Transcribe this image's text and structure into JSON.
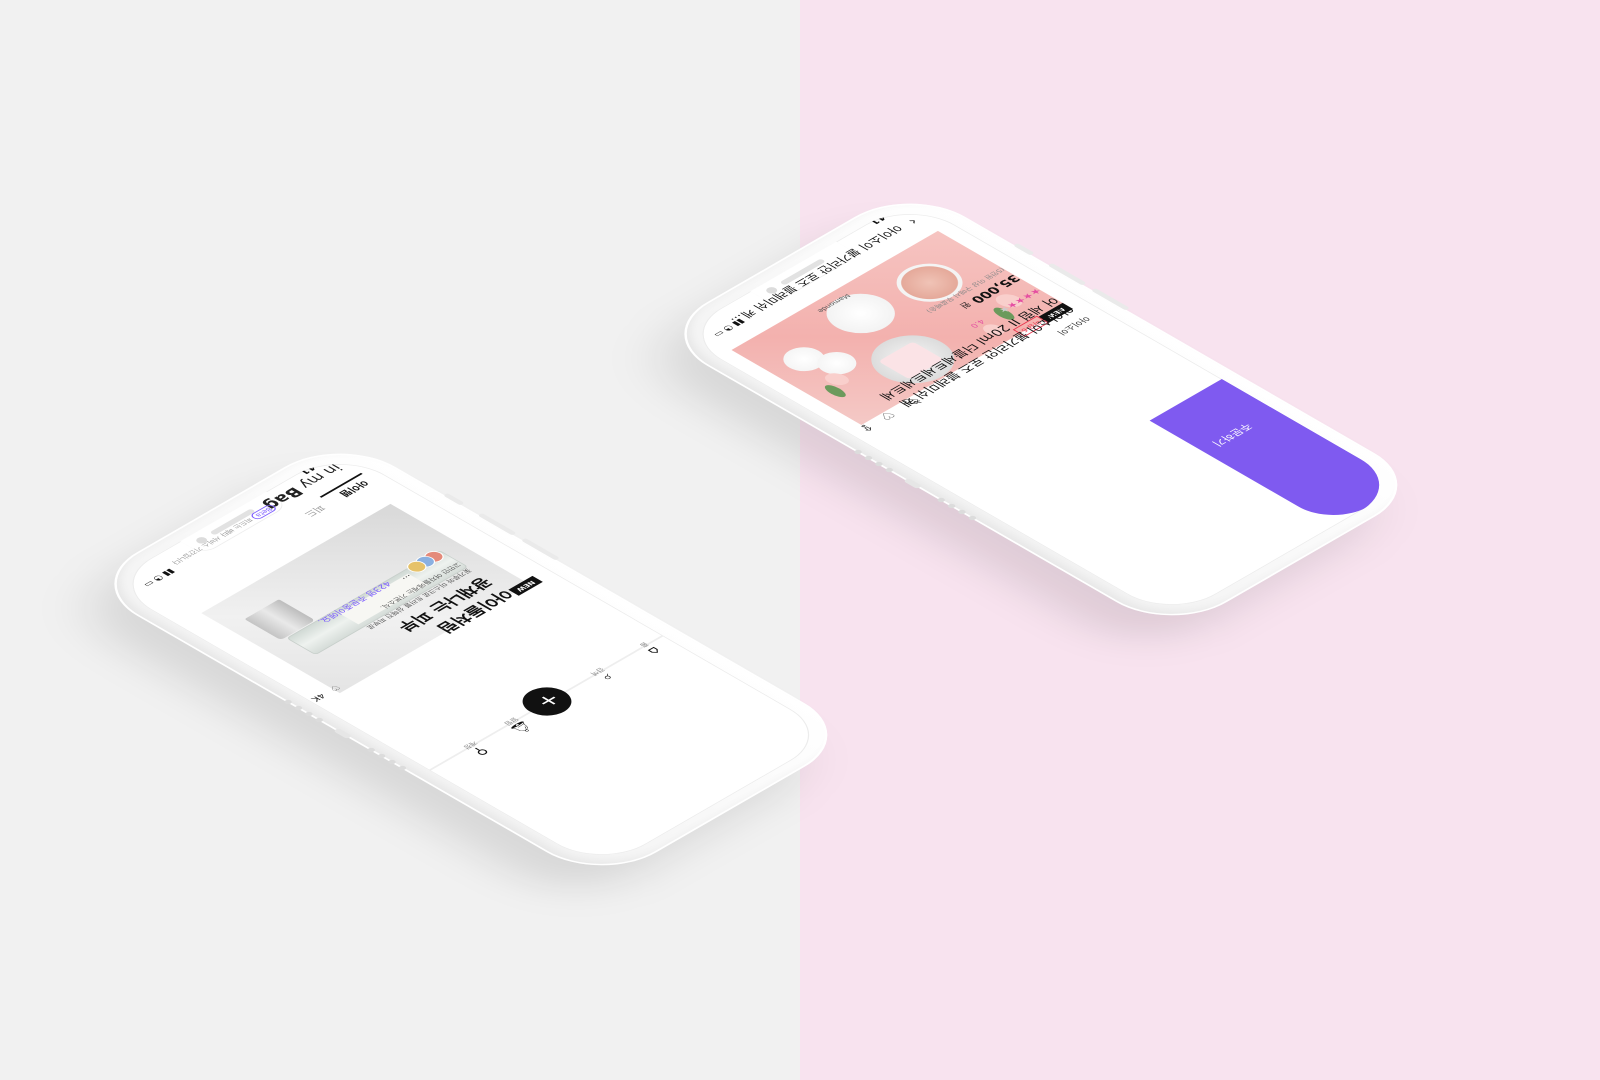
{
  "left_phone": {
    "status": {
      "time": "9:41"
    },
    "header": {
      "logo_light": "in my",
      "logo_bold": "Bag",
      "beta_badge": "Beta",
      "tagline": "피드는 베타 서비스 기간입니다"
    },
    "tabs": [
      {
        "label": "아이템",
        "active": true
      },
      {
        "label": "피드",
        "active": false
      }
    ],
    "card": {
      "badge": "NEW",
      "title_line1": "아이돌처럼",
      "title_line2": "광채나는 피부",
      "desc_line1": "꽃가루와 미스크로 트러블 심해진 피부로",
      "desc_line2": "고민인 여자들에게는 기본소식.",
      "more": "···",
      "subscribers": "423명 주문중이에요.",
      "likes": "4K"
    },
    "nav": [
      {
        "icon": "home-icon",
        "glyph": "⌂",
        "label": "홈"
      },
      {
        "icon": "search-icon",
        "glyph": "⌕",
        "label": "검색"
      },
      {
        "icon": "bell-icon",
        "glyph": "🔔︎",
        "label": "알림"
      },
      {
        "icon": "person-icon",
        "glyph": "⚲",
        "label": "계정"
      }
    ],
    "fab": "+"
  },
  "right_phone": {
    "status": {
      "time": "9:41"
    },
    "topbar": {
      "title": "아이소이 불가리안 로즈 블레미쉬 케..."
    },
    "product": {
      "badge": "NEW",
      "coupon": "마감-6",
      "image_brand_text": "Mamonde",
      "brand": "아이소이",
      "name_line1": "아이소이 불가리안 로즈 블레미쉬 케",
      "name_line2": "어 세럼 II 20ml 더블세트세트세트세",
      "stars_filled": 4,
      "stars_total": 5,
      "rating": "4.0",
      "price": "35,000",
      "price_unit": "원",
      "ship_note": "(5만원 이상 구매시 무료배송)"
    },
    "actions": [
      {
        "icon": "bookmark-icon",
        "glyph": "🔖︎"
      },
      {
        "icon": "heart-icon",
        "glyph": "♡"
      },
      {
        "icon": "share-icon",
        "glyph": "⇪"
      }
    ],
    "order_button": "주문하기"
  },
  "colors": {
    "accent_purple": "#7f5af0",
    "accent_pink": "#e54fa1",
    "bg_left": "#f1f1f1",
    "bg_right": "#f8e3ef"
  }
}
